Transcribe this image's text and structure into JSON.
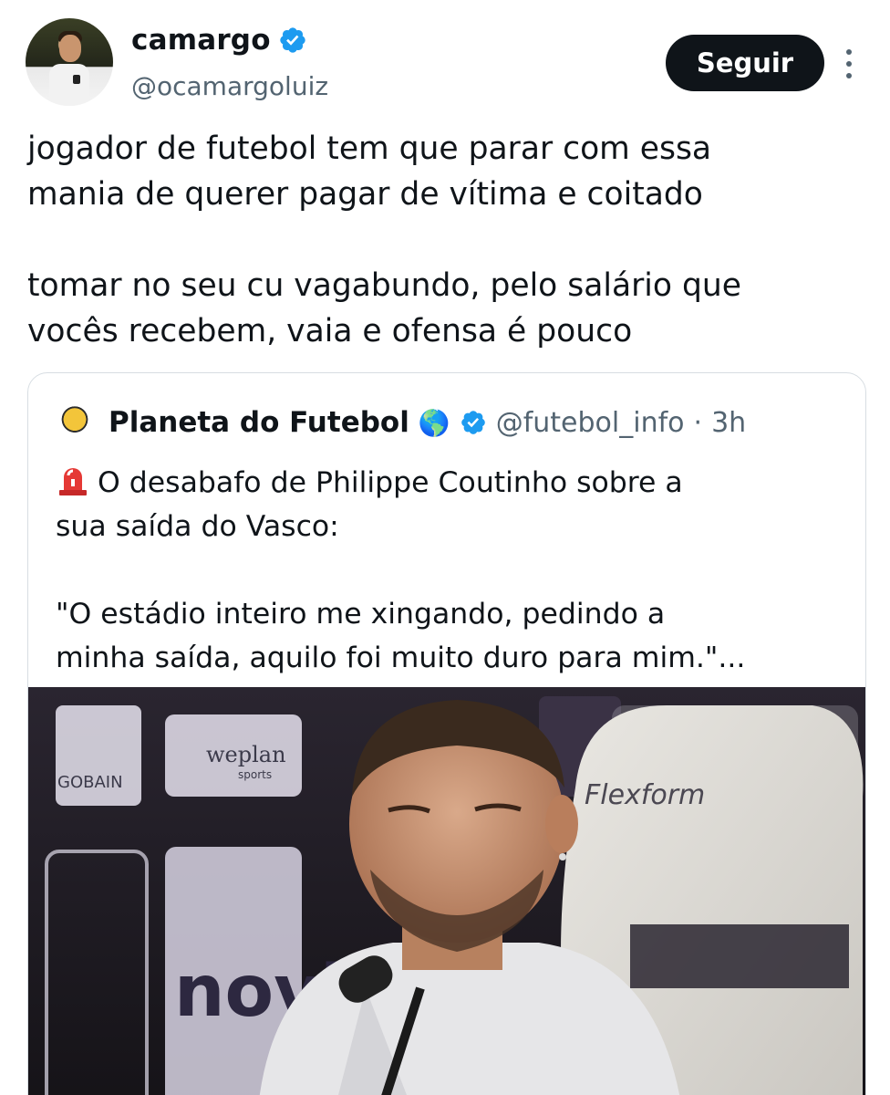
{
  "author": {
    "display_name": "camargo",
    "handle": "@ocamargoluiz",
    "verified_icon": "verified-badge-icon"
  },
  "actions": {
    "follow_label": "Seguir",
    "more_icon": "more-vertical-icon"
  },
  "tweet": {
    "text_line1": "jogador de futebol tem que parar com essa",
    "text_line2": "mania de querer pagar de vítima e coitado",
    "text_line3": "tomar no seu cu vagabundo, pelo salário que",
    "text_line4": "vocês recebem, vaia e ofensa é pouco"
  },
  "quoted": {
    "display_name": "Planeta do Futebol",
    "emoji_globe": "🌎",
    "handle": "@futebol_info",
    "separator": "·",
    "time": "3h",
    "line1": "O desabafo de Philippe Coutinho sobre a",
    "line2": "sua saída do Vasco:",
    "line3": "\"O estádio inteiro me xingando, pedindo a",
    "line4": "minha saída, aquilo foi muito duro para mim.\"..."
  },
  "media": {
    "backdrop_text_1": "GOBAIN",
    "backdrop_text_2": "weplan",
    "backdrop_text_3": "sports",
    "backdrop_text_4": "novi",
    "chair_text": "Flexform"
  },
  "colors": {
    "accent": "#1d9bf0",
    "text": "#0f1419",
    "secondary": "#536471",
    "border": "#d7dde2"
  }
}
